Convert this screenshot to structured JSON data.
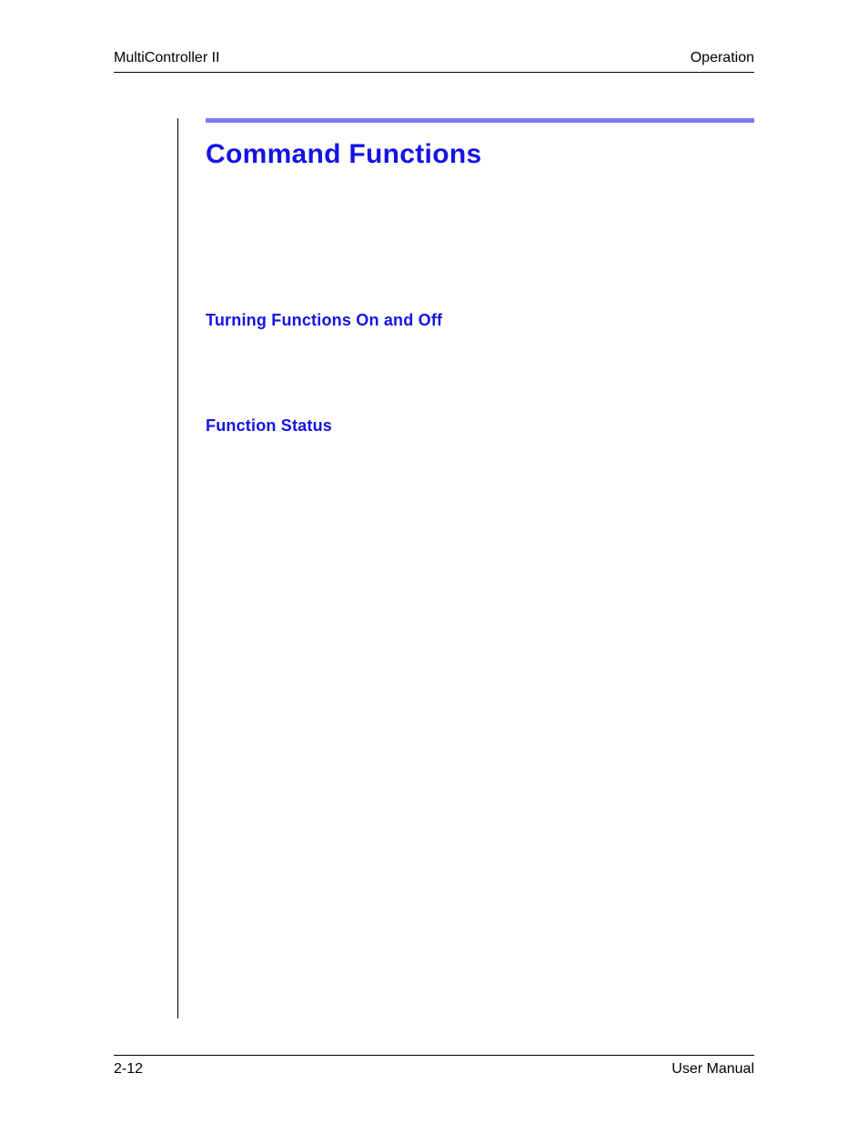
{
  "header": {
    "left": "MultiController II",
    "right": "Operation"
  },
  "section": {
    "title": "Command Functions",
    "subsections": [
      "Turning Functions On and Off",
      "Function Status"
    ]
  },
  "footer": {
    "left": "2-12",
    "right": "User Manual"
  }
}
